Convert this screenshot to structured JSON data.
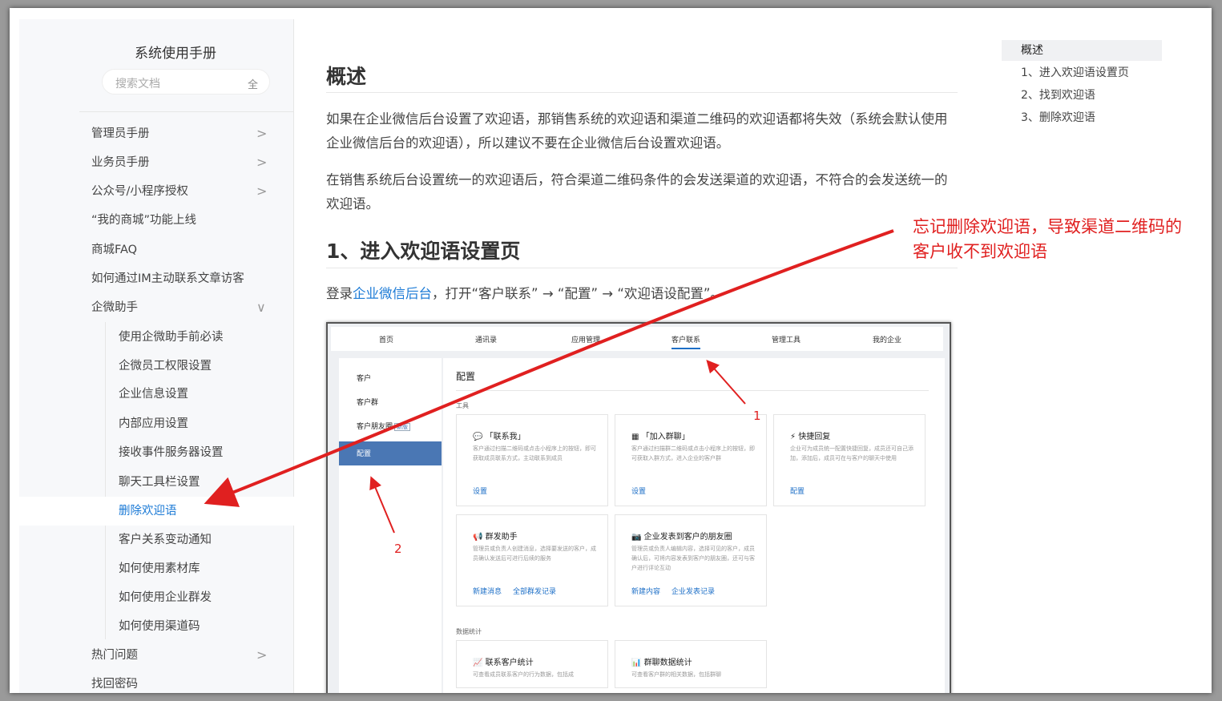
{
  "sidebar": {
    "title": "系统使用手册",
    "search_placeholder": "搜索文档",
    "search_scope": "全",
    "items": [
      {
        "label": "管理员手册",
        "chevron": ">"
      },
      {
        "label": "业务员手册",
        "chevron": ">"
      },
      {
        "label": "公众号/小程序授权",
        "chevron": ">"
      },
      {
        "label": "“我的商城”功能上线"
      },
      {
        "label": "商城FAQ"
      },
      {
        "label": "如何通过IM主动联系文章访客"
      },
      {
        "label": "企微助手",
        "chevron": "∨"
      },
      {
        "label": "使用企微助手前必读"
      },
      {
        "label": "企微员工权限设置"
      },
      {
        "label": "企业信息设置"
      },
      {
        "label": "内部应用设置"
      },
      {
        "label": "接收事件服务器设置"
      },
      {
        "label": "聊天工具栏设置"
      },
      {
        "label": "删除欢迎语"
      },
      {
        "label": "客户关系变动通知"
      },
      {
        "label": "如何使用素材库"
      },
      {
        "label": "如何使用企业群发"
      },
      {
        "label": "如何使用渠道码"
      },
      {
        "label": "热门问题",
        "chevron": ">"
      },
      {
        "label": "找回密码"
      }
    ]
  },
  "content": {
    "h_overview": "概述",
    "para1": "如果在企业微信后台设置了欢迎语，那销售系统的欢迎语和渠道二维码的欢迎语都将失效（系统会默认使用企业微信后台的欢迎语），所以建议不要在企业微信后台设置欢迎语。",
    "para2": "在销售系统后台设置统一的欢迎语后，符合渠道二维码条件的会发送渠道的欢迎语，不符合的会发送统一的欢迎语。",
    "h_step1": "1、进入欢迎语设置页",
    "login_prefix": "登录",
    "login_link": "企业微信后台",
    "login_suffix": "，打开“客户联系” → “配置” → “欢迎语设配置”。"
  },
  "screenshot": {
    "tabs": [
      "首页",
      "通讯录",
      "应用管理",
      "客户联系",
      "管理工具",
      "我的企业"
    ],
    "left_items": [
      "客户",
      "客户群",
      "客户朋友圈"
    ],
    "left_badge": "新版",
    "left_active": "配置",
    "title": "配置",
    "section_tools": "工具",
    "section_stats": "数据统计",
    "cards": [
      {
        "icon": "💬",
        "title": "「联系我」",
        "desc": "客户通过扫描二维码或点击小程序上的按钮，即可获取成员联系方式，主动联系到成员",
        "links": [
          "设置"
        ]
      },
      {
        "icon": "▦",
        "title": "「加入群聊」",
        "desc": "客户通过扫描群二维码或点击小程序上的按钮，即可获取入群方式，进入企业的客户群",
        "links": [
          "设置"
        ]
      },
      {
        "icon": "⚡",
        "title": "快捷回复",
        "desc": "企业可为成员统一配置快捷回复，成员还可自己添加，添加后，成员可在与客户的聊天中使用",
        "links": [
          "配置"
        ]
      },
      {
        "icon": "📢",
        "title": "群发助手",
        "desc": "管理员或负责人创建消息，选择要发送的客户，成员确认发送后可进行后续的服务",
        "links": [
          "新建消息",
          "全部群发记录"
        ]
      },
      {
        "icon": "📷",
        "title": "企业发表到客户的朋友圈",
        "desc": "管理员或负责人编辑内容，选择可见的客户，成员确认后，可将内容发表到客户的朋友圈，还可与客户进行评论互动",
        "links": [
          "新建内容",
          "企业发表记录"
        ]
      },
      {
        "icon": "📈",
        "title": "联系客户统计",
        "desc": "可查看成员联系客户的行为数据，包括成"
      },
      {
        "icon": "📊",
        "title": "群聊数据统计",
        "desc": "可查看客户群的相关数据，包括群聊"
      }
    ]
  },
  "toc": [
    "概述",
    "1、进入欢迎语设置页",
    "2、找到欢迎语",
    "3、删除欢迎语"
  ],
  "annotation": {
    "text": "忘记删除欢迎语，导致渠道二维码的客户收不到欢迎语",
    "label1": "1",
    "label2": "2",
    "color": "#e02020"
  },
  "colors": {
    "link": "#1d7bd6",
    "active_nav": "#4a77b4"
  }
}
